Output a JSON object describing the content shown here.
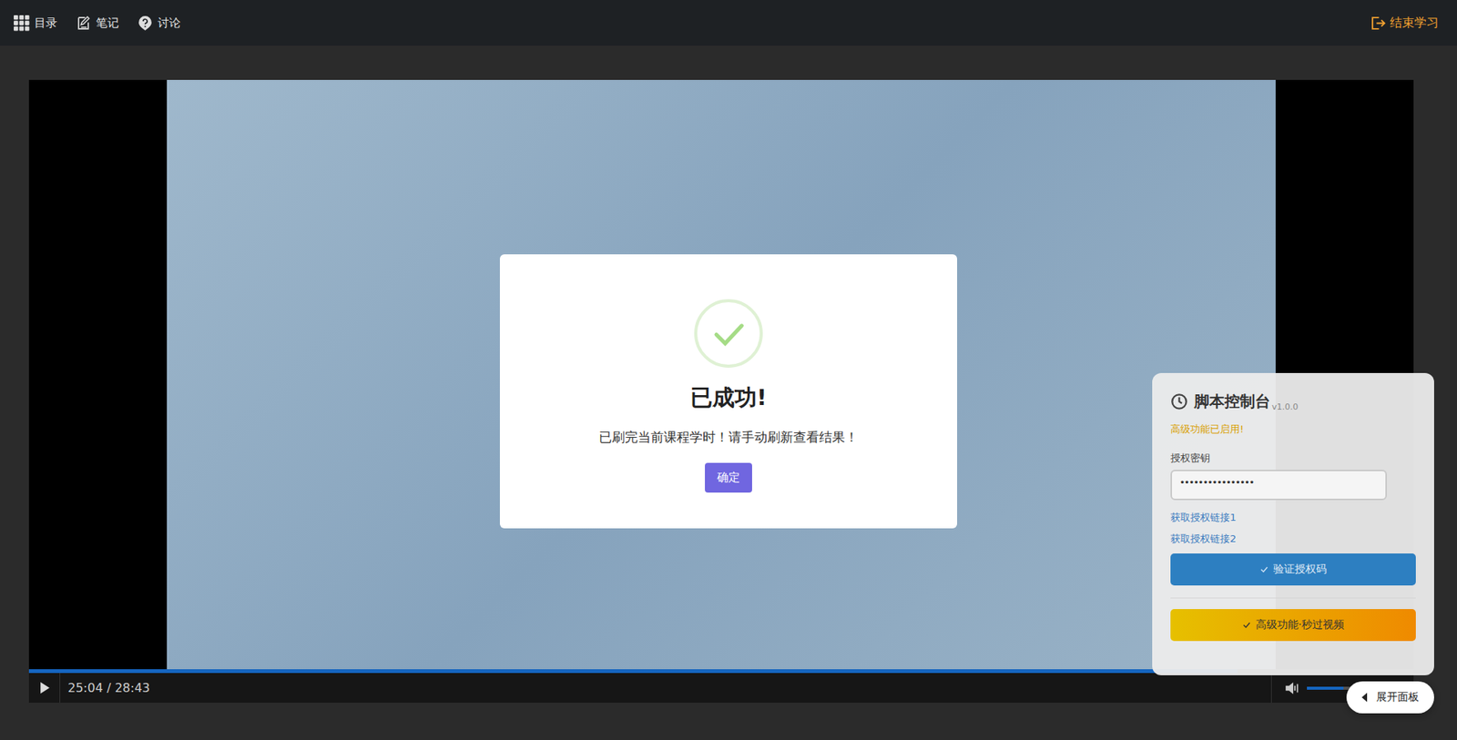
{
  "toolbar": {
    "items": [
      {
        "label": "目录"
      },
      {
        "label": "笔记"
      },
      {
        "label": "讨论"
      }
    ],
    "exit": "结束学习"
  },
  "player": {
    "playing": false,
    "time": "25:04 / 28:43",
    "progress": {
      "level": 0.873
    },
    "volume": {
      "level": 0.6
    }
  },
  "dialog": {
    "title": "已成功!",
    "message": "已刷完当前课程学时！请手动刷新查看结果！",
    "button": "确定"
  },
  "panel": {
    "title": "脚本控制台",
    "version": "v1.0.0",
    "status": "高级功能已启用!",
    "key_label": "授权密钥",
    "key_value": "••••••••••••••••",
    "links": [
      "获取授权链接1",
      "获取授权链接2"
    ],
    "verify_button": "验证授权码",
    "premium_button": "高级功能·秒过视频"
  },
  "expand_button": "展开面板"
}
